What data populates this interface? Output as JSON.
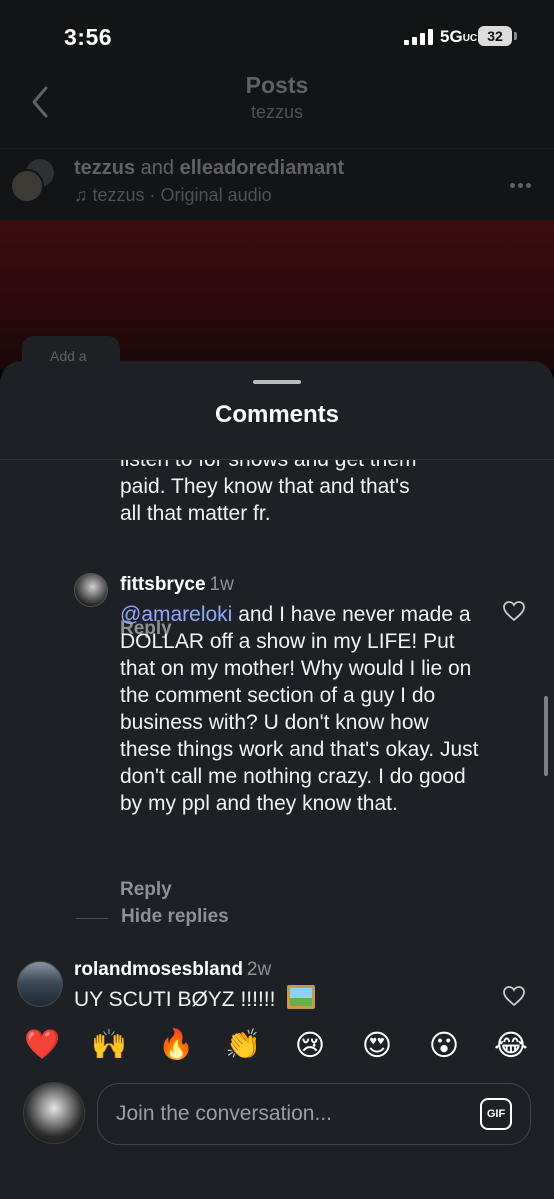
{
  "status_bar": {
    "time": "3:56",
    "network": "5G",
    "network_suffix": "UC",
    "battery": "32"
  },
  "header": {
    "title": "Posts",
    "subtitle": "tezzus"
  },
  "post": {
    "author": "tezzus",
    "and_text": " and ",
    "collaborator": "elleadorediamant",
    "audio_artist": "tezzus",
    "audio_name": " · Original audio",
    "media_button": "Add a"
  },
  "comments_sheet": {
    "title": "Comments",
    "comments": [
      {
        "text_lines": [
          "listen to for shows and get them",
          "paid. They know that and that's",
          "all that matter fr."
        ],
        "reply_label": "Reply"
      },
      {
        "username": "fittsbryce",
        "age": "1w",
        "mention": "@amareloki",
        "text": " and I have never made a DOLLAR off a show in my LIFE! Put that on my mother! Why would I lie on the comment section of a guy I do business with? U don't know how these things work and that's okay. Just don't call me nothing crazy. I do good by my ppl and they know that.",
        "reply_label": "Reply"
      },
      {
        "username": "rolandmosesbland",
        "age": "2w",
        "text": "UY SCUTI BØYZ !!!!!! ",
        "emoji": "framed-picture"
      }
    ],
    "hide_replies_label": "Hide replies"
  },
  "quick_emojis": [
    "❤️",
    "🙌",
    "🔥",
    "👏",
    "😢",
    "😍",
    "😮",
    "😂"
  ],
  "composer": {
    "placeholder": "Join the conversation...",
    "gif_label": "GIF"
  },
  "colors": {
    "sheet_bg": "#1d2125",
    "mention": "#8fa8ff",
    "secondary_text": "#8d9195"
  }
}
